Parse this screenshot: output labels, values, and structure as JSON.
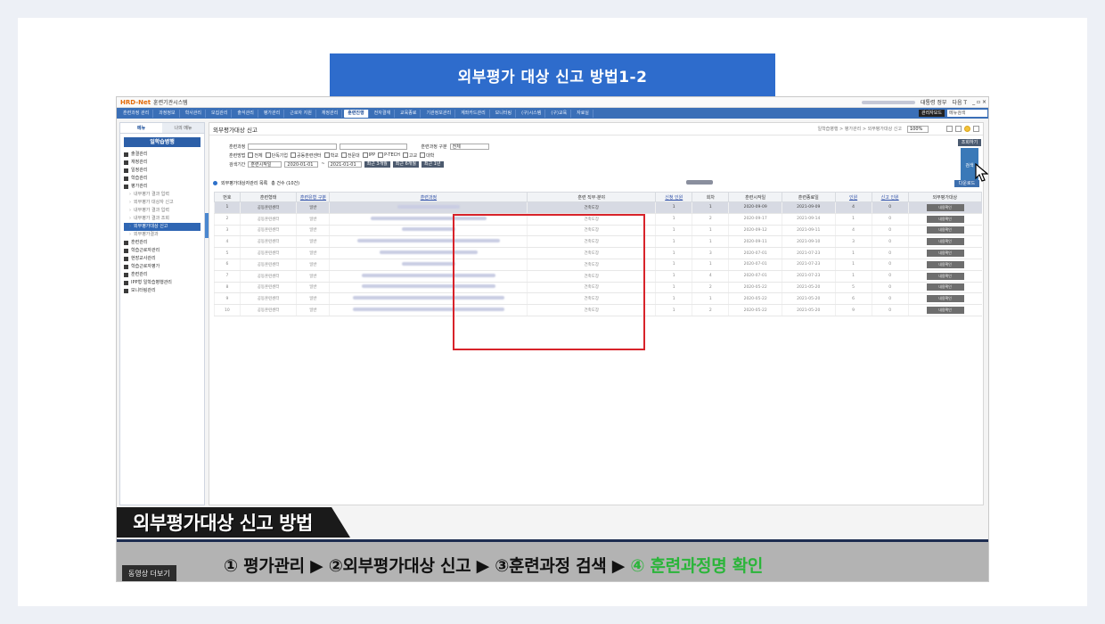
{
  "banner_title": "외부평가 대상 신고 방법1-2",
  "app": {
    "logo": "HRD-Net",
    "system_name": "훈련기관시스템",
    "top_right_label": "대통령 정부",
    "top_right_right": "다음 T"
  },
  "nav": {
    "items": [
      "훈련과정 관리",
      "과정정보",
      "학사관리",
      "모집관리",
      "출석관리",
      "평가관리",
      "근로자 지원",
      "재정관리",
      "훈련진행",
      "전자결재",
      "교육종료",
      "기관정보관리",
      "계좌카드관리",
      "모니터링",
      "(구)시스템",
      "(구)교육",
      "자료실"
    ],
    "active_index": 8,
    "right_tag": "관리자모드",
    "search_placeholder": "메뉴검색"
  },
  "sidebar": {
    "tabs": [
      "메뉴",
      "나의 메뉴"
    ],
    "title": "일학습병행",
    "items": [
      {
        "label": "출결관리",
        "type": "main"
      },
      {
        "label": "재정관리",
        "type": "main"
      },
      {
        "label": "일정관리",
        "type": "main"
      },
      {
        "label": "학습관리",
        "type": "main"
      },
      {
        "label": "평가관리",
        "type": "main"
      },
      {
        "label": "내부평가 결과 입력",
        "type": "sub"
      },
      {
        "label": "외부평가 대상자 신고",
        "type": "sub"
      },
      {
        "label": "내부평가 결과 입력",
        "type": "sub"
      },
      {
        "label": "내부평가 결과 조회",
        "type": "sub"
      },
      {
        "label": "외부평가대상 신고",
        "type": "sub",
        "highlight": true
      },
      {
        "label": "외부평가결과",
        "type": "sub"
      },
      {
        "label": "훈련관리",
        "type": "main"
      },
      {
        "label": "학습근로자관리",
        "type": "main"
      },
      {
        "label": "현장교사관리",
        "type": "main"
      },
      {
        "label": "학습근로자평가",
        "type": "main"
      },
      {
        "label": "훈련관리",
        "type": "main"
      },
      {
        "label": "IPP형 일학습병행관리",
        "type": "main"
      },
      {
        "label": "모니터링관리",
        "type": "main"
      }
    ]
  },
  "main": {
    "title": "외부평가대상 신고",
    "breadcrumb": "일학습병행 > 평가관리 > 외부평가대상 신고",
    "zoom": "100%",
    "search": {
      "course_label": "훈련과정",
      "type_label": "훈련과정 구분",
      "type_value": "전체",
      "method_label": "훈련방법",
      "methods": [
        "전체",
        "단독기업",
        "공동훈련센터",
        "학교",
        "전문대",
        "IPP",
        "P-TECH",
        "고교",
        "대학"
      ],
      "period_label": "검색기간",
      "period_type": "훈련시작일",
      "date_from": "2020-01-01",
      "date_to": "2021-01-01",
      "quick_buttons": [
        "최근 3개월",
        "최근 6개월",
        "최근 1년"
      ],
      "search_button": "검색",
      "top_button": "조회하기"
    },
    "list_title": "외부평가대상자관리 목록",
    "list_count": "총 건수 (10건)",
    "excel_button": "다운로드",
    "columns": [
      "번호",
      "훈련형태",
      "훈련유형 구분",
      "훈련과정",
      "훈련 직무·분야",
      "신청 인원",
      "회차",
      "훈련시작일",
      "훈련종료일",
      "인원",
      "신고 인원",
      "외부평가대상"
    ],
    "rows": [
      {
        "no": "1",
        "type": "공동훈련센터",
        "kind": "일반",
        "field": "건축도장",
        "apply": "1",
        "round": "1",
        "start": "2020-09-09",
        "end": "2021-09-09",
        "people": "4",
        "report": "0",
        "action": "내용확인"
      },
      {
        "no": "2",
        "type": "공동훈련센터",
        "kind": "일반",
        "field": "건축도장",
        "apply": "1",
        "round": "2",
        "start": "2020-09-17",
        "end": "2021-09-14",
        "people": "1",
        "report": "0",
        "action": "내용확인"
      },
      {
        "no": "3",
        "type": "공동훈련센터",
        "kind": "일반",
        "field": "건축도장",
        "apply": "1",
        "round": "1",
        "start": "2020-09-12",
        "end": "2021-09-11",
        "people": "4",
        "report": "0",
        "action": "내용확인"
      },
      {
        "no": "4",
        "type": "공동훈련센터",
        "kind": "일반",
        "field": "건축도장",
        "apply": "1",
        "round": "1",
        "start": "2020-09-11",
        "end": "2021-09-10",
        "people": "3",
        "report": "0",
        "action": "내용확인"
      },
      {
        "no": "5",
        "type": "공동훈련센터",
        "kind": "일반",
        "field": "건축도장",
        "apply": "1",
        "round": "3",
        "start": "2020-07-01",
        "end": "2021-07-23",
        "people": "1",
        "report": "0",
        "action": "내용확인"
      },
      {
        "no": "6",
        "type": "공동훈련센터",
        "kind": "일반",
        "field": "건축도장",
        "apply": "1",
        "round": "1",
        "start": "2020-07-01",
        "end": "2021-07-23",
        "people": "1",
        "report": "0",
        "action": "내용확인"
      },
      {
        "no": "7",
        "type": "공동훈련센터",
        "kind": "일반",
        "field": "건축도장",
        "apply": "1",
        "round": "4",
        "start": "2020-07-01",
        "end": "2021-07-23",
        "people": "1",
        "report": "0",
        "action": "내용확인"
      },
      {
        "no": "8",
        "type": "공동훈련센터",
        "kind": "일반",
        "field": "건축도장",
        "apply": "1",
        "round": "2",
        "start": "2020-05-22",
        "end": "2021-05-20",
        "people": "5",
        "report": "0",
        "action": "내용확인"
      },
      {
        "no": "9",
        "type": "공동훈련센터",
        "kind": "일반",
        "field": "건축도장",
        "apply": "1",
        "round": "1",
        "start": "2020-05-22",
        "end": "2021-05-20",
        "people": "6",
        "report": "0",
        "action": "내용확인"
      },
      {
        "no": "10",
        "type": "공동훈련센터",
        "kind": "일반",
        "field": "건축도장",
        "apply": "1",
        "round": "2",
        "start": "2020-05-22",
        "end": "2021-05-20",
        "people": "9",
        "report": "0",
        "action": "내용확인"
      }
    ]
  },
  "captions": {
    "section": "외부평가대상 신고 방법",
    "steps_prefix": "① 평가관리 ▶ ②외부평가대상 신고  ▶ ③훈련과정 검색 ▶ ",
    "steps_highlight": "④ 훈련과정명 확인",
    "more_button": "동영상 더보기"
  },
  "colors": {
    "banner": "#2e6ccc",
    "nav": "#3a6fb7",
    "highlight_box": "#d8232a",
    "step_highlight": "#2bb53a"
  }
}
